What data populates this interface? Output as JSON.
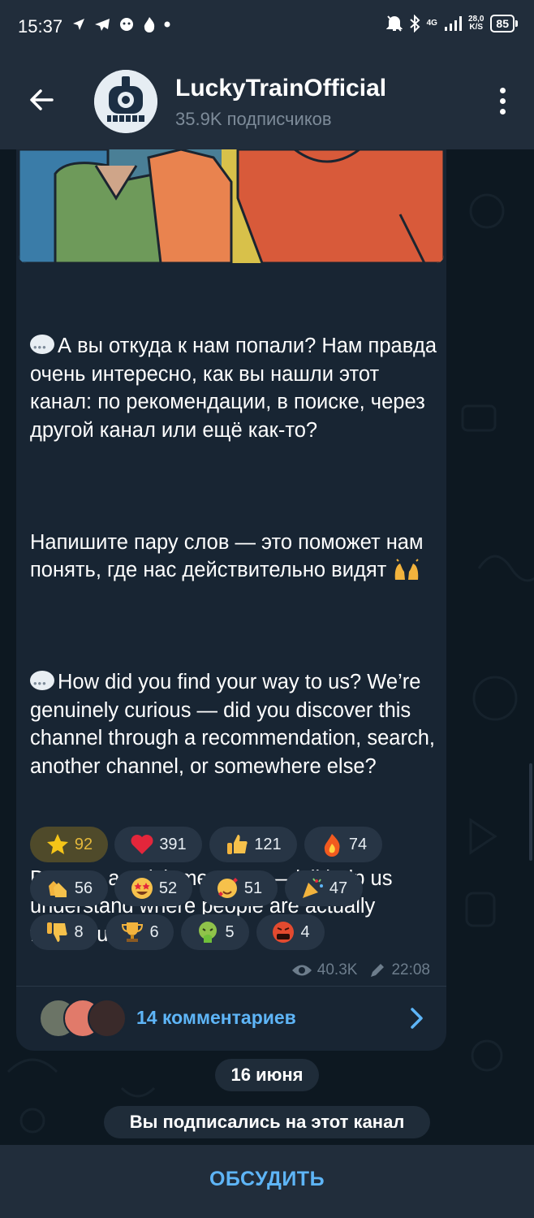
{
  "status_bar": {
    "time": "15:37",
    "net_speed_value": "28,0",
    "net_speed_unit": "K/S",
    "network": "4G",
    "battery": "85"
  },
  "header": {
    "title": "LuckyTrainOfficial",
    "subtitle": "35.9K подписчиков"
  },
  "message": {
    "paragraphs_ru": [
      "А вы откуда к нам попали? Нам правда очень интересно, как вы нашли этот канал: по рекомендации, в поиске, через другой канал или ещё как-то?",
      "Напишите пару слов — это поможет нам понять, где нас действительно видят"
    ],
    "paragraphs_en": [
      "How did you find your way to us? We’re genuinely curious — did you discover this channel through a recommendation, search, another channel, or somewhere else?",
      "Drop us a quick message — it’ll help us understand where people are actually finding us"
    ],
    "reactions": [
      {
        "icon": "star-icon",
        "count": "92",
        "active": true
      },
      {
        "icon": "heart-icon",
        "count": "391"
      },
      {
        "icon": "thumbs-up-icon",
        "count": "121"
      },
      {
        "icon": "fire-icon",
        "count": "74"
      },
      {
        "icon": "clapping-hands-icon",
        "count": "56"
      },
      {
        "icon": "star-struck-icon",
        "count": "52"
      },
      {
        "icon": "smiling-hearts-icon",
        "count": "51"
      },
      {
        "icon": "party-popper-icon",
        "count": "47"
      },
      {
        "icon": "thumbs-down-icon",
        "count": "8"
      },
      {
        "icon": "trophy-icon",
        "count": "6"
      },
      {
        "icon": "nauseated-face-icon",
        "count": "5"
      },
      {
        "icon": "cursing-face-icon",
        "count": "4"
      }
    ],
    "views": "40.3K",
    "time": "22:08",
    "comments_label": "14 комментариев"
  },
  "date_divider": "16 июня",
  "service_message": "Вы подписались на этот канал",
  "bottom_button": "ОБСУДИТЬ",
  "colors": {
    "accent": "#5eb5f7",
    "card": "#182533",
    "bar": "#212d3b"
  }
}
